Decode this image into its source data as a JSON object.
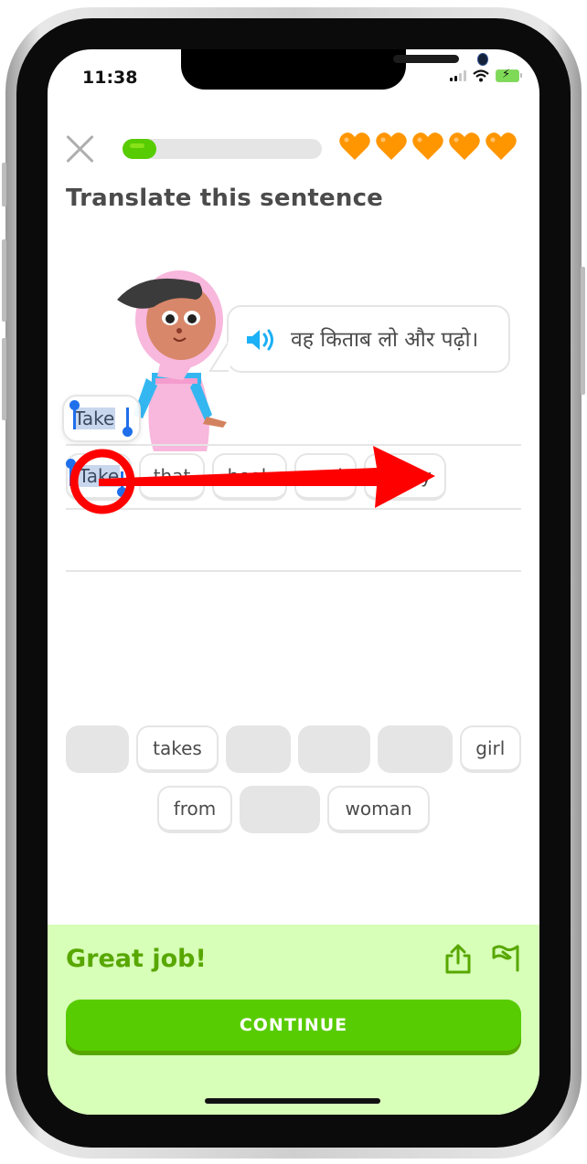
{
  "status_bar": {
    "time": "11:38"
  },
  "header": {
    "close_icon": "close-x-icon",
    "progress_fraction": 0.17,
    "hearts_count": 5,
    "heart_color": "#ff9600",
    "progress_color": "#58cc02"
  },
  "prompt": {
    "title": "Translate this sentence",
    "speaker_icon": "speaker-volume-icon",
    "sentence": "वह किताब लो और पढ़ो।"
  },
  "floating_word": {
    "label": "Take"
  },
  "answer": {
    "tiles": [
      {
        "label": "Take"
      },
      {
        "label": "that"
      },
      {
        "label": "book"
      },
      {
        "label": "and"
      },
      {
        "label": "study"
      }
    ]
  },
  "word_bank": {
    "row1": [
      {
        "label": "",
        "used": true
      },
      {
        "label": "takes",
        "used": false
      },
      {
        "label": "",
        "used": true
      },
      {
        "label": "",
        "used": true
      },
      {
        "label": "",
        "used": true
      },
      {
        "label": "girl",
        "used": false
      }
    ],
    "row2": [
      {
        "label": "from",
        "used": false
      },
      {
        "label": "",
        "used": true
      },
      {
        "label": "woman",
        "used": false
      }
    ]
  },
  "feedback": {
    "message": "Great job!",
    "share_icon": "share-icon",
    "flag_icon": "flag-report-icon",
    "continue_label": "CONTINUE",
    "accent": "#58a700",
    "background": "#d7ffb8"
  },
  "annotation": {
    "color": "#ff0000",
    "shapes": [
      "circle-highlight",
      "arrow-right"
    ]
  }
}
